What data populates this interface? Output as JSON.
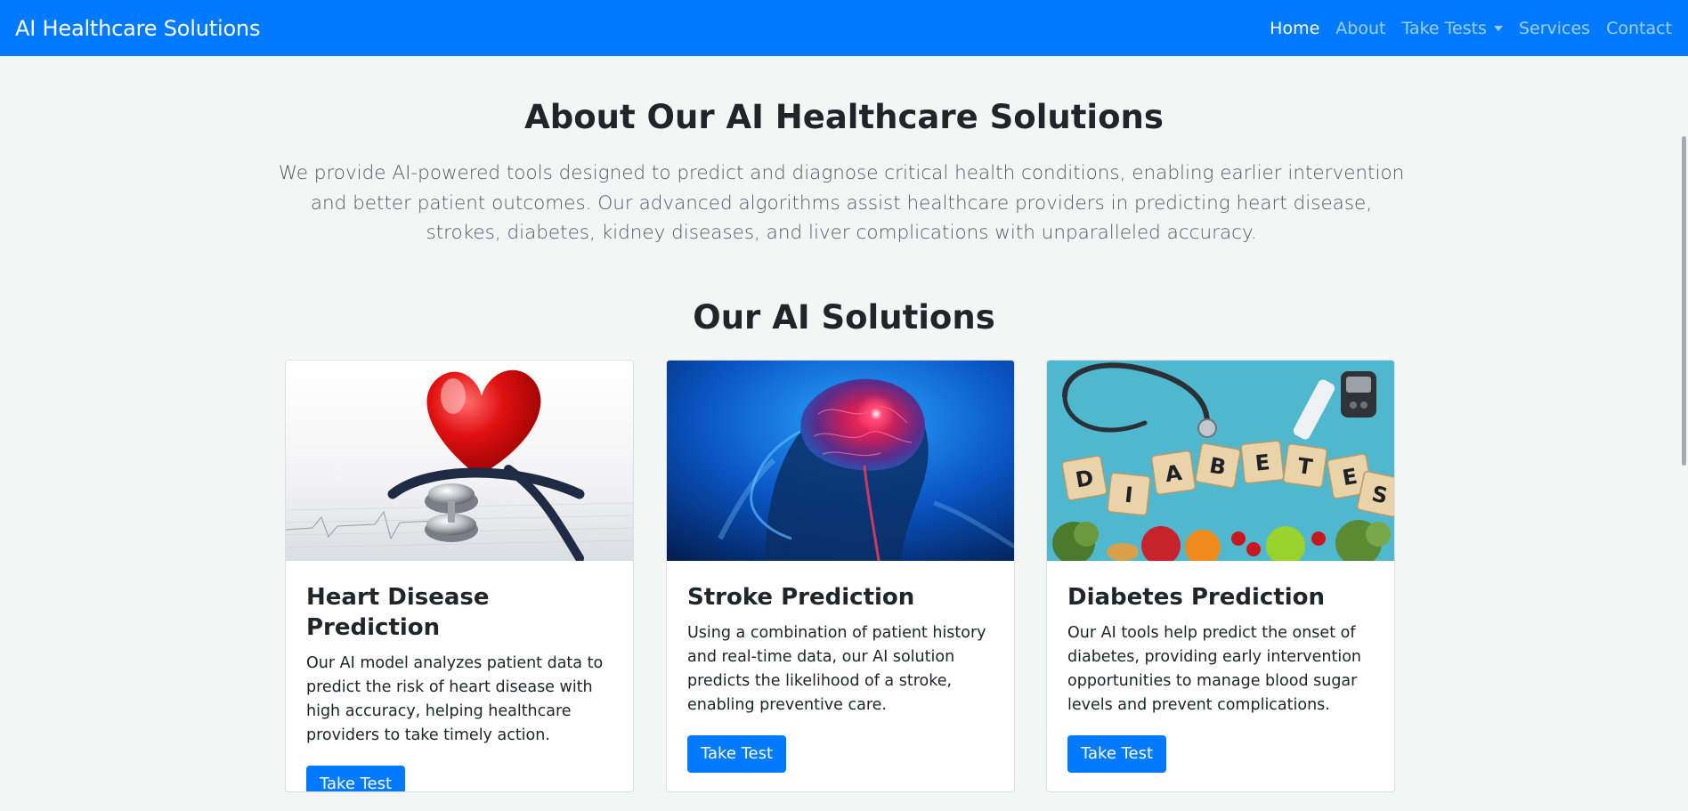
{
  "navbar": {
    "brand": "AI Healthcare Solutions",
    "items": [
      {
        "label": "Home",
        "active": true
      },
      {
        "label": "About"
      },
      {
        "label": "Take Tests",
        "dropdown": true
      },
      {
        "label": "Services"
      },
      {
        "label": "Contact"
      }
    ]
  },
  "about": {
    "title": "About Our AI Healthcare Solutions",
    "text": "We provide AI-powered tools designed to predict and diagnose critical health conditions, enabling earlier intervention and better patient outcomes. Our advanced algorithms assist healthcare providers in predicting heart disease, strokes, diabetes, kidney diseases, and liver complications with unparalleled accuracy."
  },
  "solutions": {
    "title": "Our AI Solutions",
    "cards": [
      {
        "title": "Heart Disease Prediction",
        "text": "Our AI model analyzes patient data to predict the risk of heart disease with high accuracy, helping healthcare providers to take timely action.",
        "button": "Take Test",
        "image": "heart-stethoscope-image"
      },
      {
        "title": "Stroke Prediction",
        "text": "Using a combination of patient history and real-time data, our AI solution predicts the likelihood of a stroke, enabling preventive care.",
        "button": "Take Test",
        "image": "brain-xray-image"
      },
      {
        "title": "Diabetes Prediction",
        "text": "Our AI tools help predict the onset of diabetes, providing early intervention opportunities to manage blood sugar levels and prevent complications.",
        "button": "Take Test",
        "image": "diabetes-blocks-image"
      }
    ]
  },
  "colors": {
    "primary": "#007bff",
    "background": "#f4f6f5",
    "text": "#212529"
  }
}
